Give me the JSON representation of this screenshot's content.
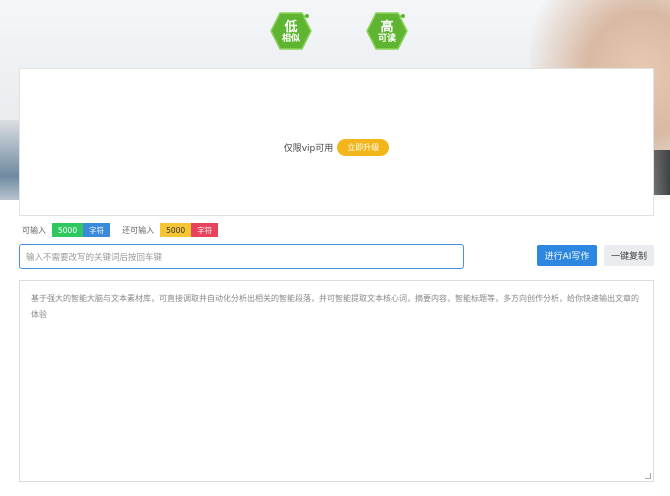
{
  "badges": {
    "low": {
      "line1": "低",
      "line2": "相似"
    },
    "high": {
      "line1": "高",
      "line2": "可读"
    },
    "color": "#5fb531"
  },
  "panel": {
    "vip_text": "仅限vip可用",
    "upgrade_label": "立即升级"
  },
  "counters": {
    "can_input_label": "可输入",
    "can_input_value": "5000",
    "can_input_unit": "字符",
    "entered_label": "还可输入",
    "entered_value": "5000",
    "entered_unit": "字符"
  },
  "input": {
    "placeholder": "输入不需要改写的关键词后按回车键"
  },
  "buttons": {
    "ai_write": "进行AI写作",
    "copy": "一键复制"
  },
  "textarea": {
    "placeholder": "基于强大的智能大脑与文本素材库，可直接调取并自动化分析出相关的智能段落，并可智能提取文本核心词，摘要内容，智能标题等，多方向创作分析，给你快速输出文章的体验"
  },
  "colors": {
    "primary": "#2d86e0",
    "upgrade": "#f3b61a",
    "green": "#2ec85e",
    "blue": "#3b8ad9",
    "yellow": "#f5c532",
    "red": "#e8435d"
  }
}
